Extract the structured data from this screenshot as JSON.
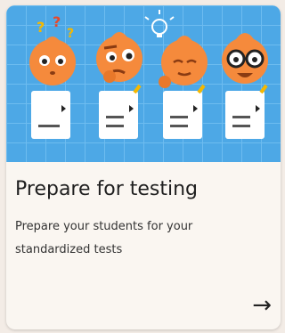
{
  "card": {
    "title": "Prepare for testing",
    "description": "Prepare your students for your standardized tests",
    "arrow": "→"
  },
  "illustration": {
    "background": "#4da8e6",
    "grid_color": "#6dbcf0",
    "character_color": "#f58a3c",
    "sheet_color": "#ffffff",
    "characters": [
      "confused-face",
      "thinking-face",
      "idea-face",
      "nerd-glasses-face"
    ]
  }
}
